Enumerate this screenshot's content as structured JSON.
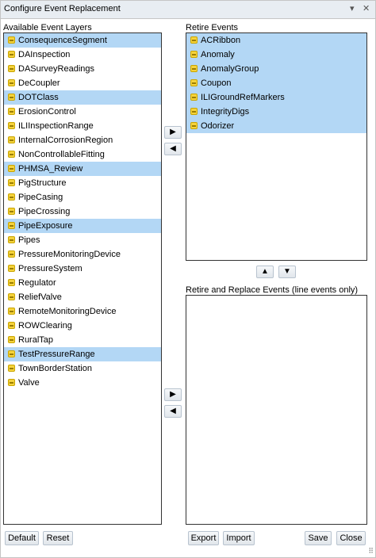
{
  "window": {
    "title": "Configure Event Replacement",
    "collapse_glyph": "▾",
    "close_glyph": "✕"
  },
  "available": {
    "label": "Available Event Layers",
    "items": [
      {
        "label": "ConsequenceSegment",
        "selected": true
      },
      {
        "label": "DAInspection",
        "selected": false
      },
      {
        "label": "DASurveyReadings",
        "selected": false
      },
      {
        "label": "DeCoupler",
        "selected": false
      },
      {
        "label": "DOTClass",
        "selected": true
      },
      {
        "label": "ErosionControl",
        "selected": false
      },
      {
        "label": "ILIInspectionRange",
        "selected": false
      },
      {
        "label": "InternalCorrosionRegion",
        "selected": false
      },
      {
        "label": "NonControllableFitting",
        "selected": false
      },
      {
        "label": "PHMSA_Review",
        "selected": true
      },
      {
        "label": "PigStructure",
        "selected": false
      },
      {
        "label": "PipeCasing",
        "selected": false
      },
      {
        "label": "PipeCrossing",
        "selected": false
      },
      {
        "label": "PipeExposure",
        "selected": true
      },
      {
        "label": "Pipes",
        "selected": false
      },
      {
        "label": "PressureMonitoringDevice",
        "selected": false
      },
      {
        "label": "PressureSystem",
        "selected": false
      },
      {
        "label": "Regulator",
        "selected": false
      },
      {
        "label": "ReliefValve",
        "selected": false
      },
      {
        "label": "RemoteMonitoringDevice",
        "selected": false
      },
      {
        "label": "ROWClearing",
        "selected": false
      },
      {
        "label": "RuralTap",
        "selected": false
      },
      {
        "label": "TestPressureRange",
        "selected": true
      },
      {
        "label": "TownBorderStation",
        "selected": false
      },
      {
        "label": "Valve",
        "selected": false
      }
    ]
  },
  "retire": {
    "label": "Retire Events",
    "items": [
      {
        "label": "ACRibbon",
        "selected": true
      },
      {
        "label": "Anomaly",
        "selected": true
      },
      {
        "label": "AnomalyGroup",
        "selected": true
      },
      {
        "label": "Coupon",
        "selected": true
      },
      {
        "label": "ILIGroundRefMarkers",
        "selected": true
      },
      {
        "label": "IntegrityDigs",
        "selected": true
      },
      {
        "label": "Odorizer",
        "selected": true
      }
    ]
  },
  "replace": {
    "label": "Retire and Replace Events (line events only)",
    "items": []
  },
  "arrows": {
    "right": "▶",
    "left": "◀",
    "up": "▲",
    "down": "▼"
  },
  "buttons": {
    "default": "Default",
    "reset": "Reset",
    "export": "Export",
    "import": "Import",
    "save": "Save",
    "close": "Close"
  },
  "colors": {
    "selection": "#b3d7f5",
    "titlebar": "#e8edf2"
  }
}
